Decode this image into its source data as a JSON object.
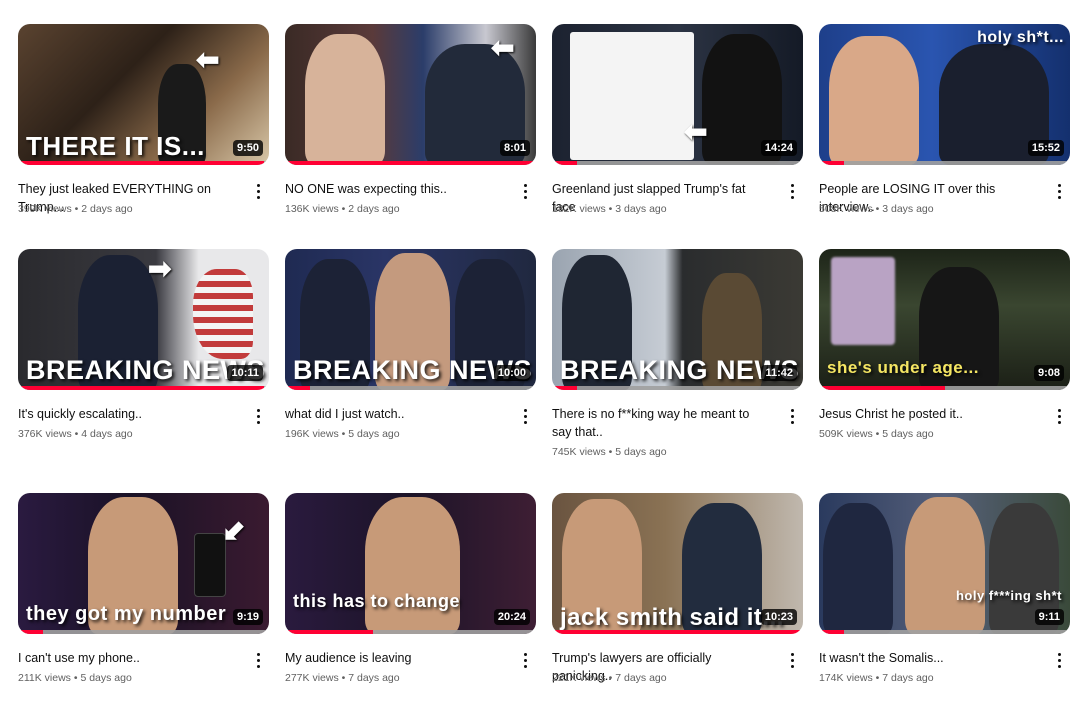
{
  "videos": [
    {
      "title": "They just leaked EVERYTHING on Trump...",
      "views": "399K views",
      "age": "2 days ago",
      "duration": "9:50",
      "overlay": "THERE IT IS...",
      "progress": 0.98
    },
    {
      "title": "NO ONE was expecting this..",
      "views": "136K views",
      "age": "2 days ago",
      "duration": "8:01",
      "overlay": "",
      "progress": 1.0
    },
    {
      "title": "Greenland just slapped Trump's fat face",
      "views": "182K views",
      "age": "3 days ago",
      "duration": "14:24",
      "overlay": "",
      "progress": 0.1
    },
    {
      "title": "People are LOSING IT over this interview..",
      "views": "508K views",
      "age": "3 days ago",
      "duration": "15:52",
      "overlay": "holy sh*t...",
      "progress": 0.1
    },
    {
      "title": "It's quickly escalating..",
      "views": "376K views",
      "age": "4 days ago",
      "duration": "10:11",
      "overlay": "BREAKING NEWS",
      "progress": 0.98
    },
    {
      "title": "what did I just watch..",
      "views": "196K views",
      "age": "5 days ago",
      "duration": "10:00",
      "overlay": "BREAKING NEWS",
      "progress": 0.1
    },
    {
      "title": "There is no f**king way he meant to say that..",
      "views": "745K views",
      "age": "5 days ago",
      "duration": "11:42",
      "overlay": "BREAKING NEWS",
      "progress": 0.1
    },
    {
      "title": "Jesus Christ he posted it..",
      "views": "509K views",
      "age": "5 days ago",
      "duration": "9:08",
      "overlay": "she's under age...",
      "progress": 0.5
    },
    {
      "title": "I can't use my phone..",
      "views": "211K views",
      "age": "5 days ago",
      "duration": "9:19",
      "overlay": "they got my number",
      "progress": 0.1
    },
    {
      "title": "My audience is leaving",
      "views": "277K views",
      "age": "7 days ago",
      "duration": "20:24",
      "overlay": "this has to change",
      "progress": 0.35
    },
    {
      "title": "Trump's lawyers are officially panicking..",
      "views": "221K views",
      "age": "7 days ago",
      "duration": "10:23",
      "overlay": "jack smith said it...",
      "progress": 1.0
    },
    {
      "title": "It wasn't the Somalis...",
      "views": "174K views",
      "age": "7 days ago",
      "duration": "9:11",
      "overlay": "holy f***ing sh*t",
      "progress": 0.1
    }
  ],
  "colors": {
    "progress": "#ff0033",
    "text": "#0f0f0f",
    "meta": "#606060",
    "overlay_yellow": "#f5e663"
  }
}
